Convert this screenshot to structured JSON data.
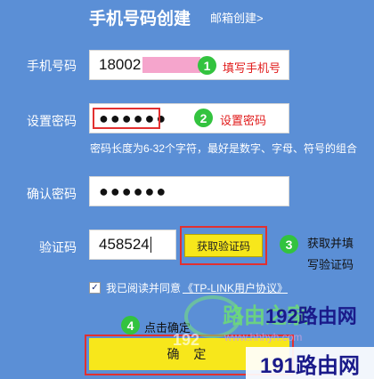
{
  "header": {
    "title": "手机号码创建",
    "email_link": "邮箱创建>"
  },
  "form": {
    "phone_label": "手机号码",
    "phone_value": "18002",
    "password_label": "设置密码",
    "password_value": "●●●●●●",
    "password_hint": "密码长度为6-32个字符，最好是数字、字母、符号的组合",
    "confirm_label": "确认密码",
    "confirm_value": "●●●●●●",
    "code_label": "验证码",
    "code_value": "458524",
    "get_code_button": "获取验证码",
    "agree_checkmark": "✓",
    "agree_text": "我已阅读并同意",
    "agree_link": "《TP-LINK用户协议》",
    "submit_button": "确 定"
  },
  "annotations": {
    "step1_number": "1",
    "step1_text": "填写手机号",
    "step2_number": "2",
    "step2_text": "设置密码",
    "step3_number": "3",
    "step3_text_line1": "获取并填",
    "step3_text_line2": "写验证码",
    "step4_number": "4",
    "step4_text": "点击确定"
  },
  "watermarks": {
    "wm1_text": "路由之家",
    "wm1_sub": "192",
    "wm1_url": "www.hhhyh.com",
    "wm2_text": "192路由网",
    "wm3_text": "191路由网"
  },
  "colors": {
    "background": "#5b8fd6",
    "accent_yellow": "#f7e71b",
    "annotation_red": "#e11b1b",
    "badge_green": "#33c33f",
    "redact_pink": "#f5a5cc"
  }
}
